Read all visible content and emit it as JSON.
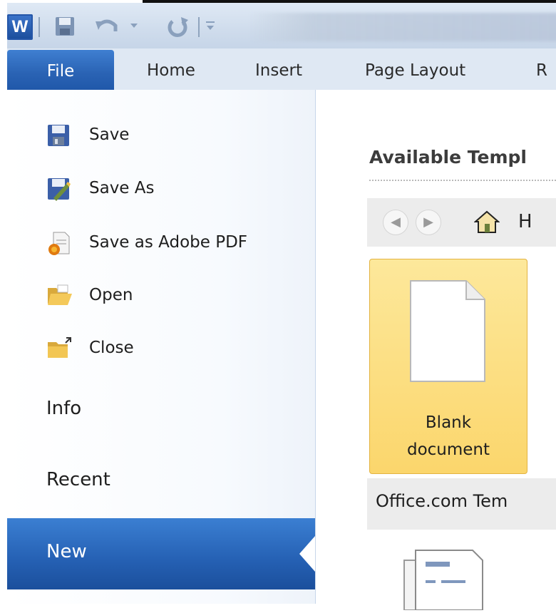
{
  "app": {
    "logo_letter": "W"
  },
  "quick_access": {
    "items": [
      "save-icon",
      "undo-icon",
      "undo-dropdown-icon",
      "redo-icon",
      "customize-qat-icon"
    ]
  },
  "ribbon": {
    "file_tab": "File",
    "tabs": [
      "Home",
      "Insert",
      "Page Layout",
      "R"
    ]
  },
  "backstage": {
    "commands": [
      {
        "label": "Save",
        "icon": "save-icon"
      },
      {
        "label": "Save As",
        "icon": "save-as-icon"
      },
      {
        "label": "Save as Adobe PDF",
        "icon": "pdf-icon"
      },
      {
        "label": "Open",
        "icon": "open-folder-icon"
      },
      {
        "label": "Close",
        "icon": "close-folder-icon"
      }
    ],
    "sections": [
      "Info",
      "Recent",
      "New"
    ],
    "selected": "New"
  },
  "content": {
    "available_templates_title": "Available Templ",
    "nav_home_text": "H",
    "blank_document_label_line1": "Blank",
    "blank_document_label_line2": "document",
    "office_com_templates": "Office.com Tem"
  },
  "colors": {
    "accent_blue": "#2a63b4",
    "tile_yellow": "#fbd66c",
    "panel_gray": "#ececec"
  }
}
